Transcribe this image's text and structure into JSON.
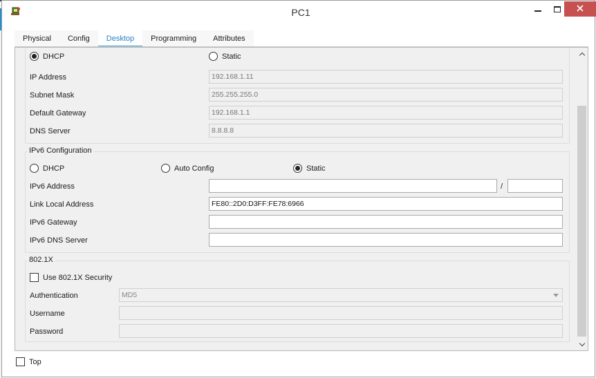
{
  "window": {
    "title": "PC1",
    "icon": "packet-tracer-pc-icon",
    "controls": {
      "minimize": "minimize-icon",
      "maximize": "maximize-icon",
      "close": "close-icon"
    }
  },
  "tabs": [
    {
      "label": "Physical",
      "active": false
    },
    {
      "label": "Config",
      "active": false
    },
    {
      "label": "Desktop",
      "active": true
    },
    {
      "label": "Programming",
      "active": false
    },
    {
      "label": "Attributes",
      "active": false
    }
  ],
  "ipv4": {
    "dhcp_label": "DHCP",
    "dhcp_selected": true,
    "static_label": "Static",
    "static_selected": false,
    "ip_label": "IP Address",
    "ip_value": "192.168.1.11",
    "mask_label": "Subnet Mask",
    "mask_value": "255.255.255.0",
    "gateway_label": "Default Gateway",
    "gateway_value": "192.168.1.1",
    "dns_label": "DNS Server",
    "dns_value": "8.8.8.8"
  },
  "ipv6": {
    "title": "IPv6 Configuration",
    "dhcp_label": "DHCP",
    "auto_label": "Auto Config",
    "static_label": "Static",
    "selected": "Static",
    "address_label": "IPv6 Address",
    "address_value": "",
    "prefix_separator": "/",
    "prefix_value": "",
    "link_local_label": "Link Local Address",
    "link_local_value": "FE80::2D0:D3FF:FE78:6966",
    "gateway_label": "IPv6 Gateway",
    "gateway_value": "",
    "dns_label": "IPv6 DNS Server",
    "dns_value": ""
  },
  "dot1x": {
    "title": "802.1X",
    "use_label": "Use 802.1X Security",
    "use_checked": false,
    "auth_label": "Authentication",
    "auth_value": "MD5",
    "username_label": "Username",
    "username_value": "",
    "password_label": "Password",
    "password_value": ""
  },
  "footer": {
    "top_label": "Top",
    "top_checked": false
  },
  "colors": {
    "accent": "#2a9ad6",
    "close_button": "#c75050",
    "panel_bg": "#f0f0f0"
  }
}
